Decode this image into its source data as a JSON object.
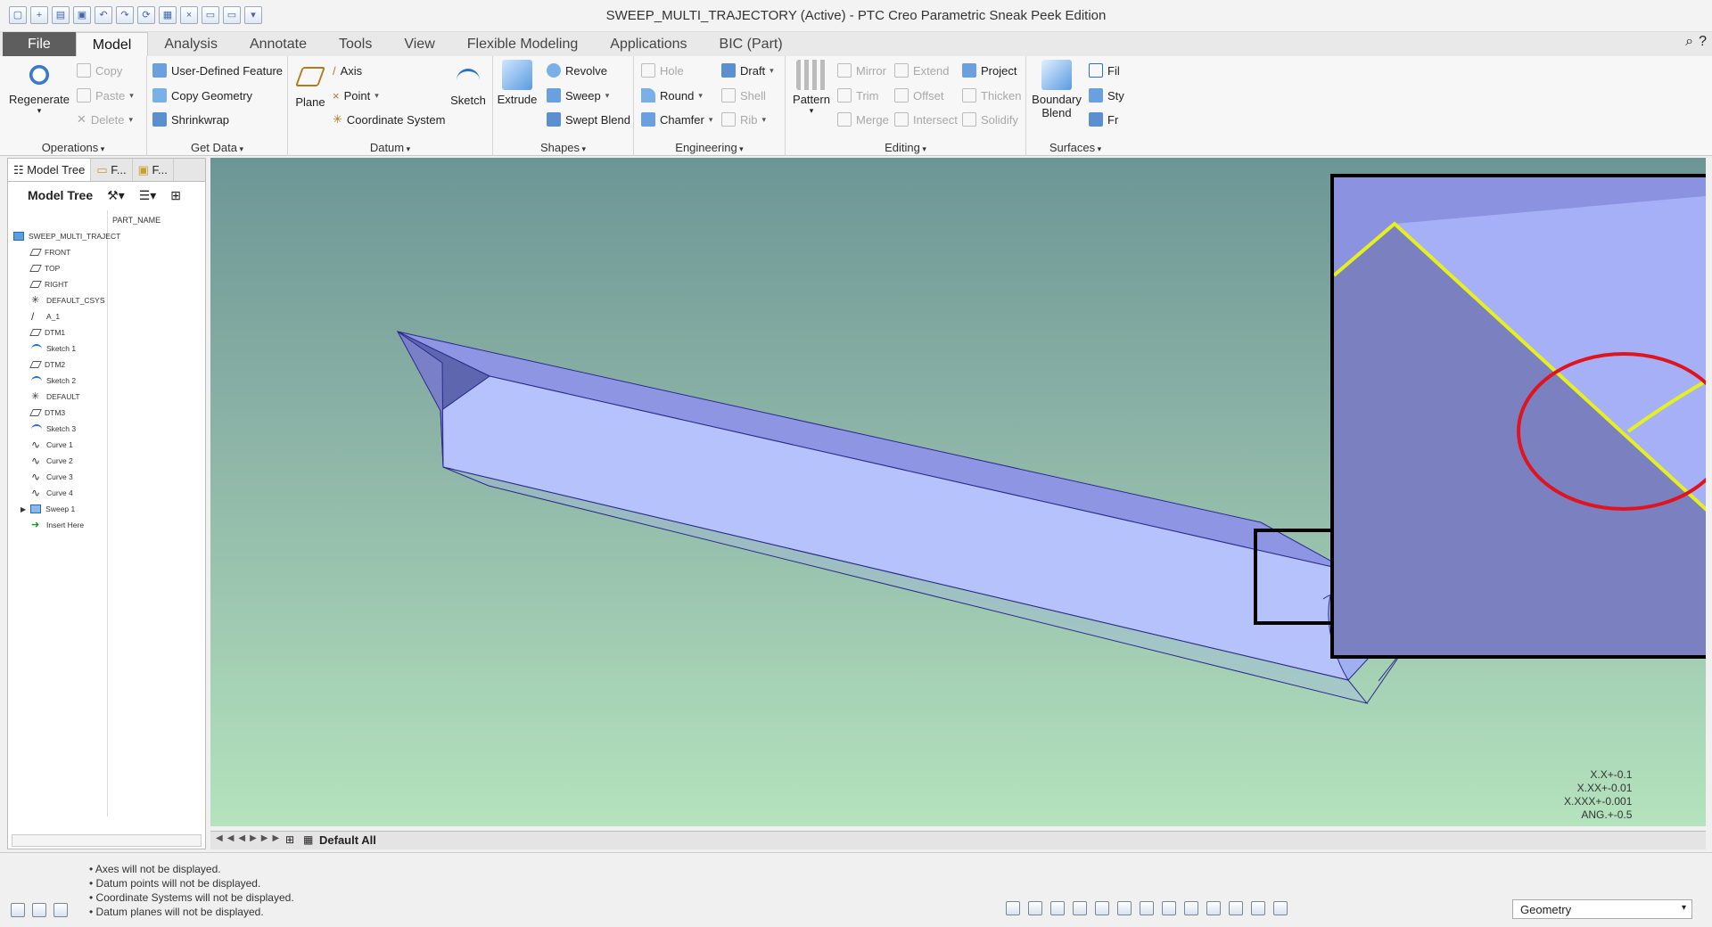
{
  "window": {
    "title": "SWEEP_MULTI_TRAJECTORY (Active) - PTC Creo Parametric Sneak Peek Edition"
  },
  "tabs": [
    {
      "label": "File"
    },
    {
      "label": "Model"
    },
    {
      "label": "Analysis"
    },
    {
      "label": "Annotate"
    },
    {
      "label": "Tools"
    },
    {
      "label": "View"
    },
    {
      "label": "Flexible Modeling"
    },
    {
      "label": "Applications"
    },
    {
      "label": "BIC (Part)"
    }
  ],
  "ribbon": {
    "operations": {
      "label": "Operations",
      "regenerate": "Regenerate",
      "copy": "Copy",
      "paste": "Paste",
      "delete": "Delete"
    },
    "get_data": {
      "label": "Get Data",
      "udf": "User-Defined Feature",
      "copy_geometry": "Copy Geometry",
      "shrinkwrap": "Shrinkwrap"
    },
    "datum": {
      "label": "Datum",
      "plane": "Plane",
      "axis": "Axis",
      "point": "Point",
      "csys": "Coordinate System",
      "sketch": "Sketch"
    },
    "shapes": {
      "label": "Shapes",
      "extrude": "Extrude",
      "revolve": "Revolve",
      "sweep": "Sweep",
      "swept_blend": "Swept Blend"
    },
    "engineering": {
      "label": "Engineering",
      "hole": "Hole",
      "round": "Round",
      "chamfer": "Chamfer",
      "draft": "Draft",
      "shell": "Shell",
      "rib": "Rib"
    },
    "editing": {
      "label": "Editing",
      "pattern": "Pattern",
      "mirror": "Mirror",
      "trim": "Trim",
      "merge": "Merge",
      "extend": "Extend",
      "offset": "Offset",
      "intersect": "Intersect",
      "project": "Project",
      "thicken": "Thicken",
      "solidify": "Solidify"
    },
    "surfaces": {
      "label": "Surfaces",
      "boundary_blend": "Boundary\nBlend",
      "fill": "Fil",
      "style": "Sty",
      "freestyle": "Fr"
    }
  },
  "left_panel": {
    "tab_model_tree": "Model Tree",
    "tab_folder": "F...",
    "tab_favorites": "F...",
    "title": "Model Tree",
    "column_header": "PART_NAME",
    "items": [
      {
        "label": "SWEEP_MULTI_TRAJECT",
        "icon": "part-icon"
      },
      {
        "label": "FRONT",
        "icon": "datum-plane-icon"
      },
      {
        "label": "TOP",
        "icon": "datum-plane-icon"
      },
      {
        "label": "RIGHT",
        "icon": "datum-plane-icon"
      },
      {
        "label": "DEFAULT_CSYS",
        "icon": "csys-icon"
      },
      {
        "label": "A_1",
        "icon": "axis-icon"
      },
      {
        "label": "DTM1",
        "icon": "datum-plane-icon"
      },
      {
        "label": "Sketch 1",
        "icon": "sketch-icon"
      },
      {
        "label": "DTM2",
        "icon": "datum-plane-icon"
      },
      {
        "label": "Sketch 2",
        "icon": "sketch-icon"
      },
      {
        "label": "DEFAULT",
        "icon": "csys-icon"
      },
      {
        "label": "DTM3",
        "icon": "datum-plane-icon"
      },
      {
        "label": "Sketch 3",
        "icon": "sketch-icon"
      },
      {
        "label": "Curve 1",
        "icon": "curve-icon"
      },
      {
        "label": "Curve 2",
        "icon": "curve-icon"
      },
      {
        "label": "Curve 3",
        "icon": "curve-icon"
      },
      {
        "label": "Curve 4",
        "icon": "curve-icon"
      },
      {
        "label": "Sweep 1",
        "icon": "sweep-icon"
      },
      {
        "label": "Insert Here",
        "icon": "insert-arrow-icon"
      }
    ]
  },
  "viewport": {
    "tolerance_lines": [
      "X.X+-0.1",
      "X.XX+-0.01",
      "X.XXX+-0.001",
      "ANG.+-0.5"
    ],
    "model_bar_label": "Default All"
  },
  "status": {
    "messages": [
      "Axes will not be displayed.",
      "Datum points will not be displayed.",
      "Coordinate Systems will not be displayed.",
      "Datum planes will not be displayed."
    ],
    "filter_value": "Geometry"
  },
  "colors": {
    "viewport_top": "#6c9696",
    "viewport_bottom": "#b4e3bd",
    "highlight_edge": "#e6f01e",
    "callout_circle": "#e0141e",
    "model_face_light": "#b5c2fb",
    "model_face_dark": "#8e96e3"
  }
}
